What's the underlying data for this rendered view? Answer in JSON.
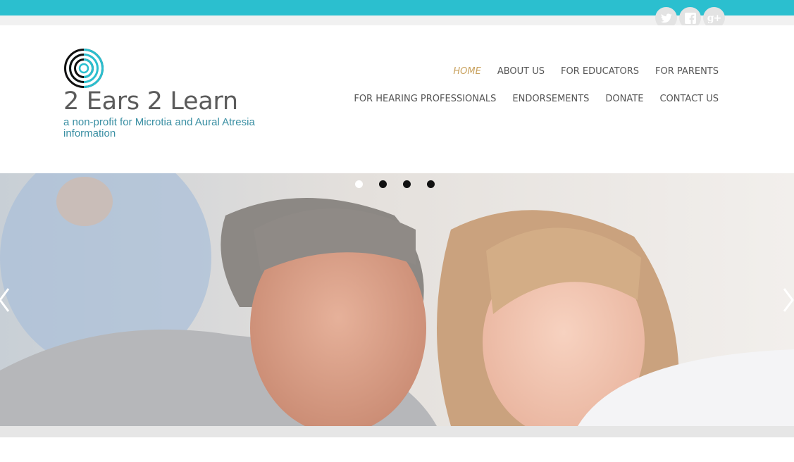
{
  "colors": {
    "accent": "#2bbfcf",
    "nav_active": "#c9a25e",
    "tagline": "#3a8fa3",
    "title": "#5b5b5b"
  },
  "social": [
    {
      "name": "twitter",
      "icon": "twitter-icon"
    },
    {
      "name": "facebook",
      "icon": "facebook-icon"
    },
    {
      "name": "google-plus",
      "icon": "google-plus-icon",
      "glyph": "g+"
    }
  ],
  "site": {
    "title": "2 Ears 2 Learn",
    "tagline": "a non-profit for Microtia and Aural Atresia information"
  },
  "nav": {
    "row1": [
      {
        "label": "HOME",
        "active": true
      },
      {
        "label": "ABOUT US"
      },
      {
        "label": "FOR EDUCATORS"
      },
      {
        "label": "FOR PARENTS"
      }
    ],
    "row2": [
      {
        "label": "FOR HEARING PROFESSIONALS"
      },
      {
        "label": "ENDORSEMENTS"
      },
      {
        "label": "DONATE"
      },
      {
        "label": "CONTACT US"
      }
    ]
  },
  "slider": {
    "slide_count": 4,
    "active_index": 0,
    "image": "father and daughter looking at a laptop screen",
    "prev_icon": "chevron-left-icon",
    "next_icon": "chevron-right-icon"
  }
}
